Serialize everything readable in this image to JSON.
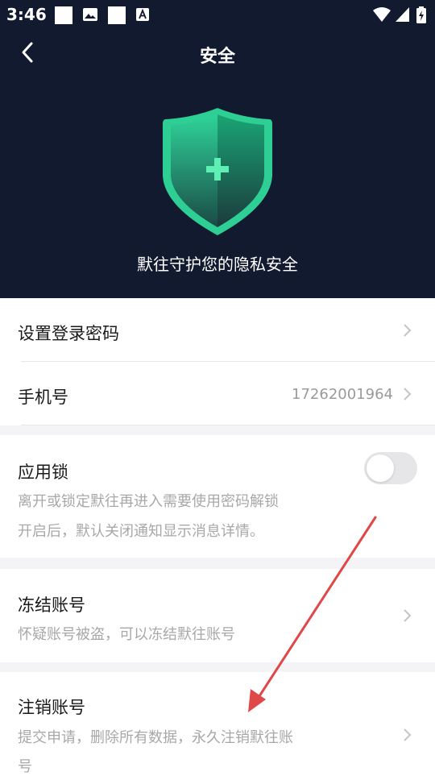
{
  "status_bar": {
    "time": "3:46"
  },
  "header": {
    "title": "安全",
    "slogan": "默往守护您的隐私安全"
  },
  "settings": {
    "login_password": {
      "label": "设置登录密码"
    },
    "phone": {
      "label": "手机号",
      "value": "17262001964"
    },
    "app_lock": {
      "label": "应用锁",
      "desc_line1": "离开或锁定默往再进入需要使用密码解锁",
      "desc_line2": "开启后，默认关闭通知显示消息详情。",
      "enabled": false
    },
    "freeze": {
      "label": "冻结账号",
      "desc": "怀疑账号被盗，可以冻结默往账号"
    },
    "cancel": {
      "label": "注销账号",
      "desc_line1": "提交申请，删除所有数据，永久注销默往账",
      "desc_line2": "号"
    }
  },
  "colors": {
    "header_bg": "#121a2f",
    "shield_green": "#1fbf86",
    "annotation_arrow": "#e04848"
  }
}
